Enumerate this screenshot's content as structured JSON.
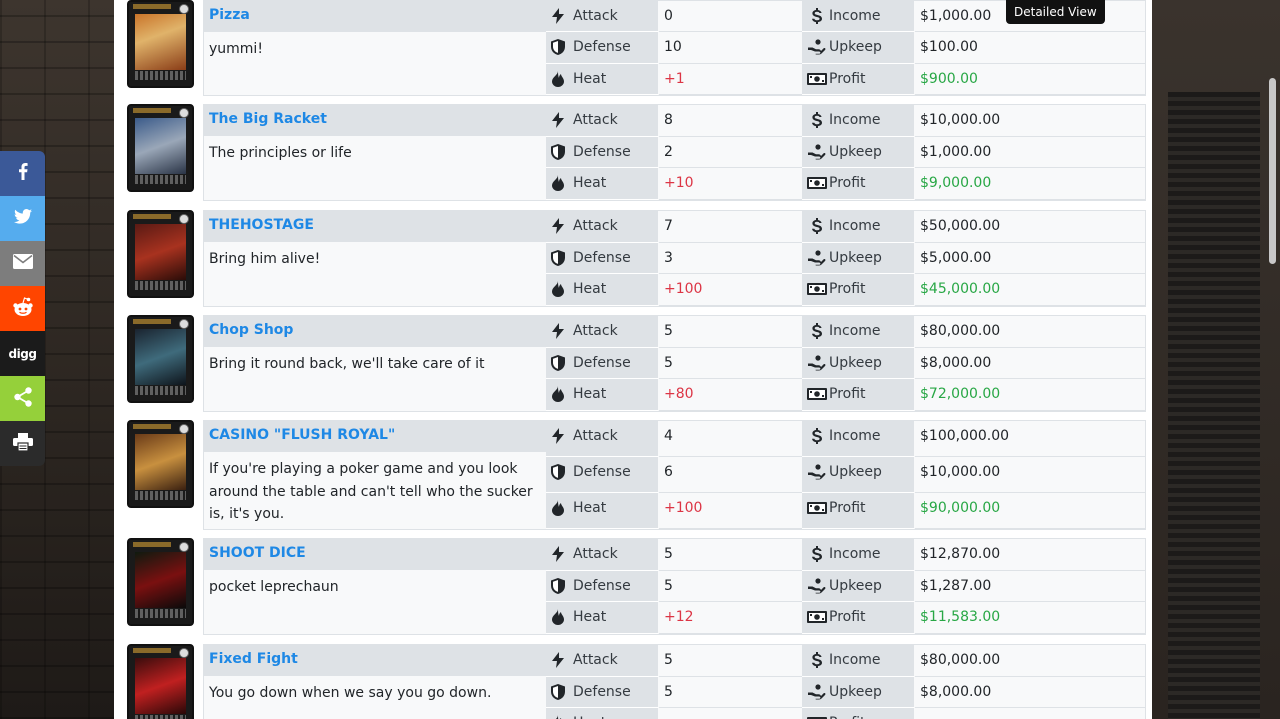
{
  "tooltip": "Detailed View",
  "stat_labels": {
    "attack": "Attack",
    "defense": "Defense",
    "heat": "Heat",
    "income": "Income",
    "upkeep": "Upkeep",
    "profit": "Profit"
  },
  "share": {
    "digg": "digg"
  },
  "colors": {
    "link": "#1e88e5",
    "heat": "#dc3545",
    "profit": "#28a745",
    "facebook": "#3b5998",
    "twitter": "#55acee",
    "email": "#7d7d7d",
    "reddit": "#ff4500",
    "digg": "#1b1b1b",
    "sharethis": "#95d03a",
    "print": "#2b2b2b"
  },
  "businesses": [
    {
      "name": "Pizza",
      "description": "yummi!",
      "attack": "0",
      "defense": "10",
      "heat": "+1",
      "income": "$1,000.00",
      "upkeep": "$100.00",
      "profit": "$900.00"
    },
    {
      "name": "The Big Racket",
      "description": "The principles or life",
      "attack": "8",
      "defense": "2",
      "heat": "+10",
      "income": "$10,000.00",
      "upkeep": "$1,000.00",
      "profit": "$9,000.00"
    },
    {
      "name": "THEHOSTAGE",
      "description": "Bring him alive!",
      "attack": "7",
      "defense": "3",
      "heat": "+100",
      "income": "$50,000.00",
      "upkeep": "$5,000.00",
      "profit": "$45,000.00"
    },
    {
      "name": "Chop Shop",
      "description": "Bring it round back, we'll take care of it",
      "attack": "5",
      "defense": "5",
      "heat": "+80",
      "income": "$80,000.00",
      "upkeep": "$8,000.00",
      "profit": "$72,000.00"
    },
    {
      "name": "CASINO \"FLUSH ROYAL\"",
      "description": "If you're playing a poker game and you look around the table and can't tell who the sucker is, it's you.",
      "attack": "4",
      "defense": "6",
      "heat": "+100",
      "income": "$100,000.00",
      "upkeep": "$10,000.00",
      "profit": "$90,000.00"
    },
    {
      "name": "SHOOT DICE",
      "description": "pocket leprechaun",
      "attack": "5",
      "defense": "5",
      "heat": "+12",
      "income": "$12,870.00",
      "upkeep": "$1,287.00",
      "profit": "$11,583.00"
    },
    {
      "name": "Fixed Fight",
      "description": "You go down when we say you go down.",
      "attack": "5",
      "defense": "5",
      "heat": "",
      "income": "$80,000.00",
      "upkeep": "$8,000.00",
      "profit": ""
    }
  ]
}
